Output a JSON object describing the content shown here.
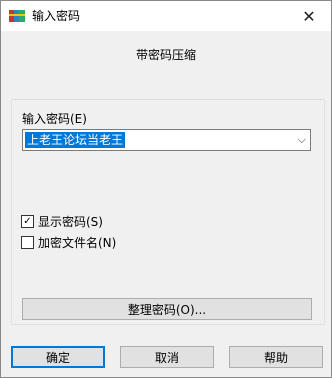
{
  "window": {
    "title": "输入密码",
    "app_icon": "winrar-books-icon",
    "close_glyph": "✕"
  },
  "dialog": {
    "subtitle": "带密码压缩",
    "password_label": "输入密码(E)",
    "password_value": "上老王论坛当老王",
    "dropdown_glyph": "⌵",
    "show_password": {
      "label": "显示密码(S)",
      "checked": true,
      "check_glyph": "✓"
    },
    "encrypt_filenames": {
      "label": "加密文件名(N)",
      "checked": false
    },
    "organize_button": "整理密码(O)..."
  },
  "footer": {
    "ok": "确定",
    "cancel": "取消",
    "help": "帮助"
  },
  "colors": {
    "accent": "#0078d7"
  }
}
